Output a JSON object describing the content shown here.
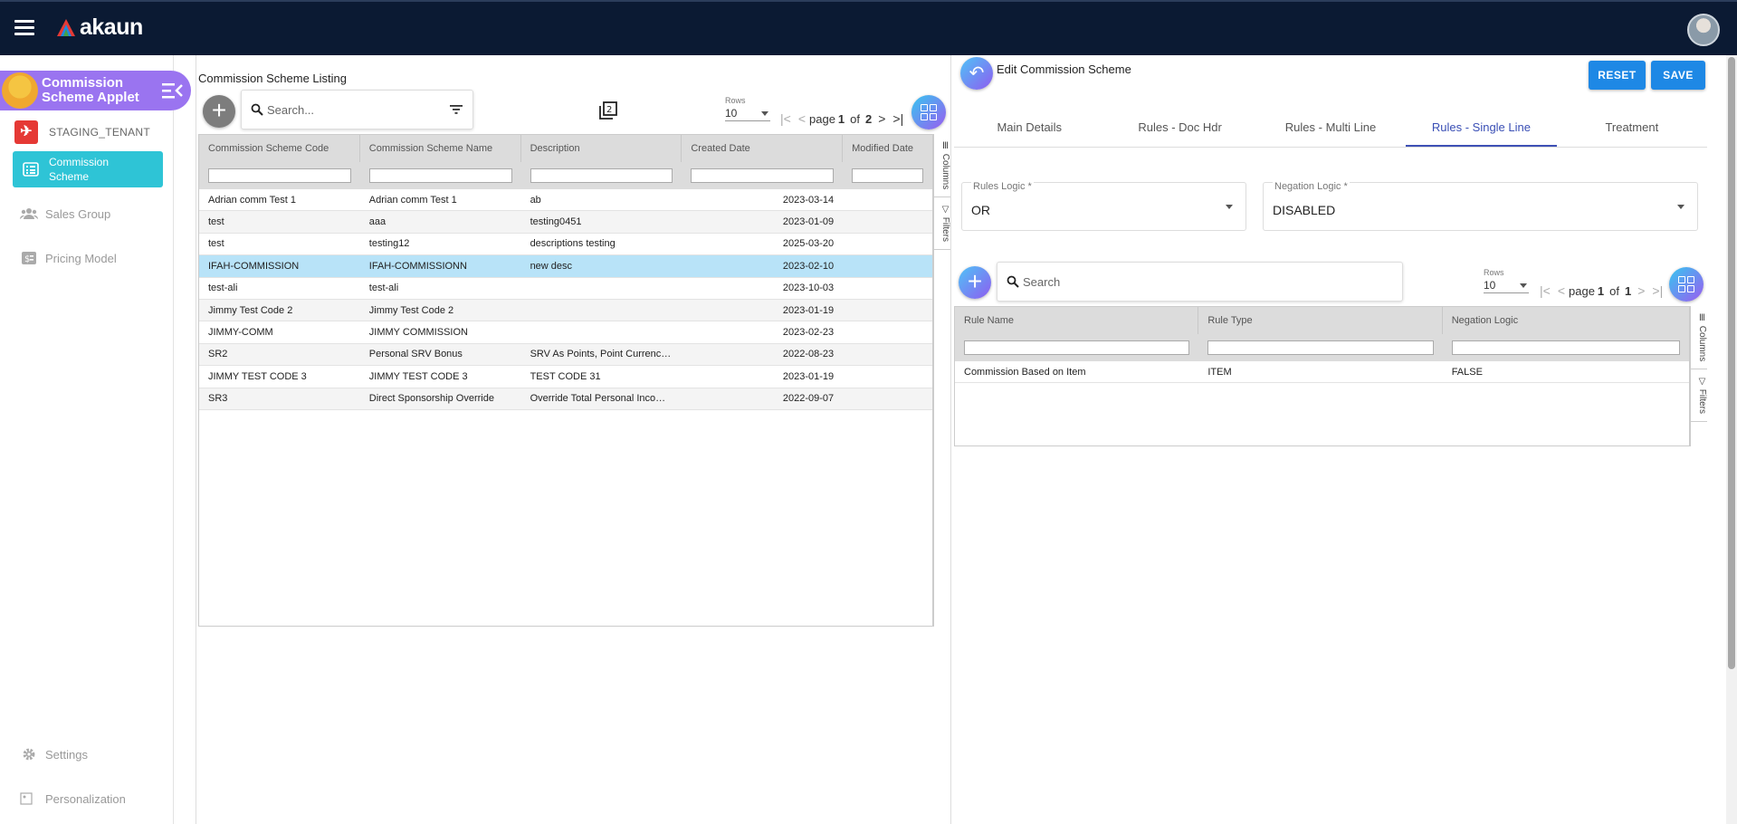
{
  "app": {
    "brand": "akaun"
  },
  "sidebar": {
    "applet_title": "Commission Scheme Applet",
    "tenant": "STAGING_TENANT",
    "items": [
      {
        "label": "Commission Scheme",
        "active": true
      },
      {
        "label": "Sales Group"
      },
      {
        "label": "Pricing Model"
      }
    ],
    "bottom": [
      {
        "label": "Settings"
      },
      {
        "label": "Personalization"
      }
    ]
  },
  "listing": {
    "title": "Commission Scheme Listing",
    "search_placeholder": "Search...",
    "rows_label": "Rows",
    "rows_value": "10",
    "page_word": "page",
    "page_current": "1",
    "of_word": "of",
    "page_total": "2",
    "columns": [
      "Commission Scheme Code",
      "Commission Scheme Name",
      "Description",
      "Created Date",
      "Modified Date"
    ],
    "rows": [
      [
        "Adrian comm Test 1",
        "Adrian comm Test 1",
        "ab",
        "2023-03-14",
        ""
      ],
      [
        "test",
        "aaa",
        "testing0451",
        "2023-01-09",
        ""
      ],
      [
        "test",
        "testing12",
        "descriptions testing",
        "2025-03-20",
        ""
      ],
      [
        "IFAH-COMMISSION",
        "IFAH-COMMISSIONN",
        "new desc",
        "2023-02-10",
        ""
      ],
      [
        "test-ali",
        "test-ali",
        "",
        "2023-10-03",
        ""
      ],
      [
        "Jimmy Test Code 2",
        "Jimmy Test Code 2",
        "",
        "2023-01-19",
        ""
      ],
      [
        "JIMMY-COMM",
        "JIMMY COMMISSION",
        "",
        "2023-02-23",
        ""
      ],
      [
        "SR2",
        "Personal SRV Bonus",
        "SRV As Points, Point Currency C...",
        "2022-08-23",
        ""
      ],
      [
        "JIMMY TEST CODE 3",
        "JIMMY TEST CODE 3",
        "TEST CODE 31",
        "2023-01-19",
        ""
      ],
      [
        "SR3",
        "Direct Sponsorship Override",
        "Override Total Personal Income...",
        "2022-09-07",
        ""
      ]
    ],
    "side_tabs": [
      "Columns",
      "Filters"
    ]
  },
  "edit": {
    "title": "Edit Commission Scheme",
    "reset_label": "RESET",
    "save_label": "SAVE",
    "tabs": [
      "Main Details",
      "Rules - Doc Hdr",
      "Rules - Multi Line",
      "Rules - Single Line",
      "Treatment"
    ],
    "active_tab": 3,
    "rules_logic_label": "Rules Logic *",
    "rules_logic_value": "OR",
    "negation_logic_label": "Negation Logic *",
    "negation_logic_value": "DISABLED",
    "search_placeholder": "Search",
    "rows_label": "Rows",
    "rows_value": "10",
    "page_word": "page",
    "page_current": "1",
    "of_word": "of",
    "page_total": "1",
    "columns": [
      "Rule Name",
      "Rule Type",
      "Negation Logic"
    ],
    "rows": [
      [
        "Commission Based on Item",
        "ITEM",
        "FALSE"
      ]
    ],
    "side_tabs": [
      "Columns",
      "Filters"
    ]
  }
}
